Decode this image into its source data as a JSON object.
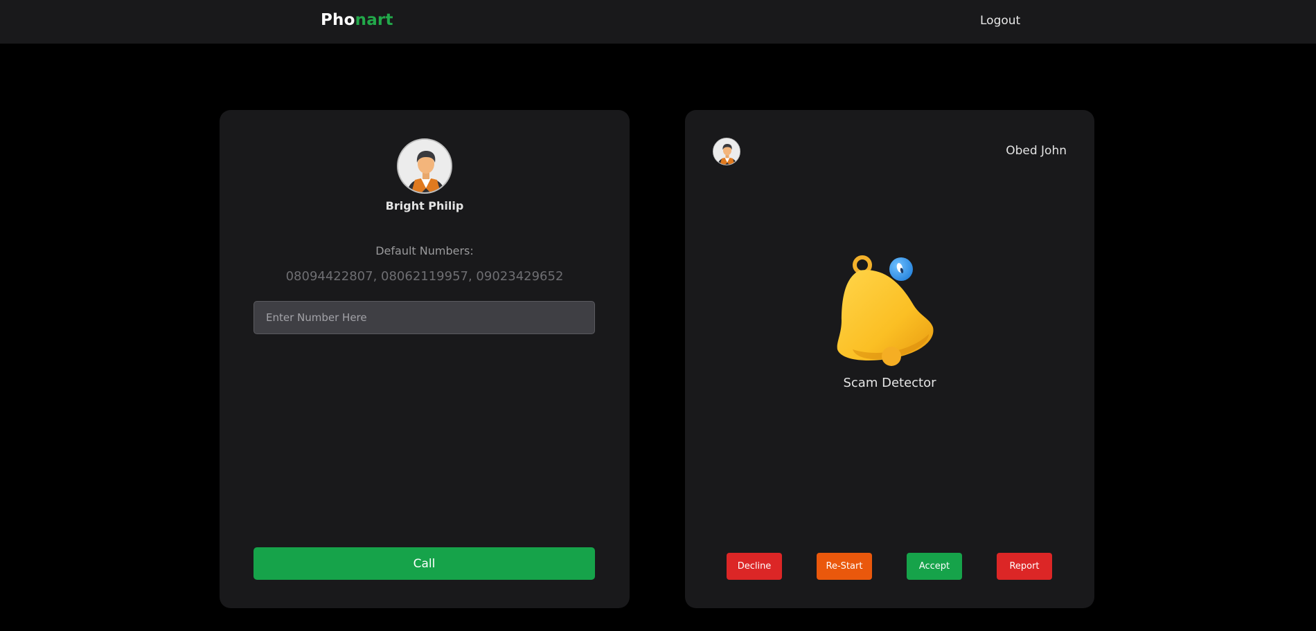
{
  "navbar": {
    "logo_part1": "Pho",
    "logo_part2": "nart",
    "logout_label": "Logout"
  },
  "caller_panel": {
    "user_name": "Bright Philip",
    "default_numbers_label": "Default Numbers:",
    "default_numbers": "08094422807, 08062119957, 09023429652",
    "input_placeholder": "Enter Number Here",
    "input_value": "",
    "call_label": "Call"
  },
  "incoming_panel": {
    "caller_name": "Obed John",
    "status_label": "Scam Detector",
    "icon": "bell-icon",
    "buttons": {
      "decline": "Decline",
      "restart": "Re-Start",
      "accept": "Accept",
      "report": "Report"
    }
  },
  "colors": {
    "background": "#000000",
    "surface": "#19191b",
    "brand_green": "#22a84a",
    "success": "#16a34a",
    "danger": "#dc2626",
    "warning": "#ea580c",
    "bell": "#fbbf24",
    "badge_blue": "#3b9eea"
  }
}
